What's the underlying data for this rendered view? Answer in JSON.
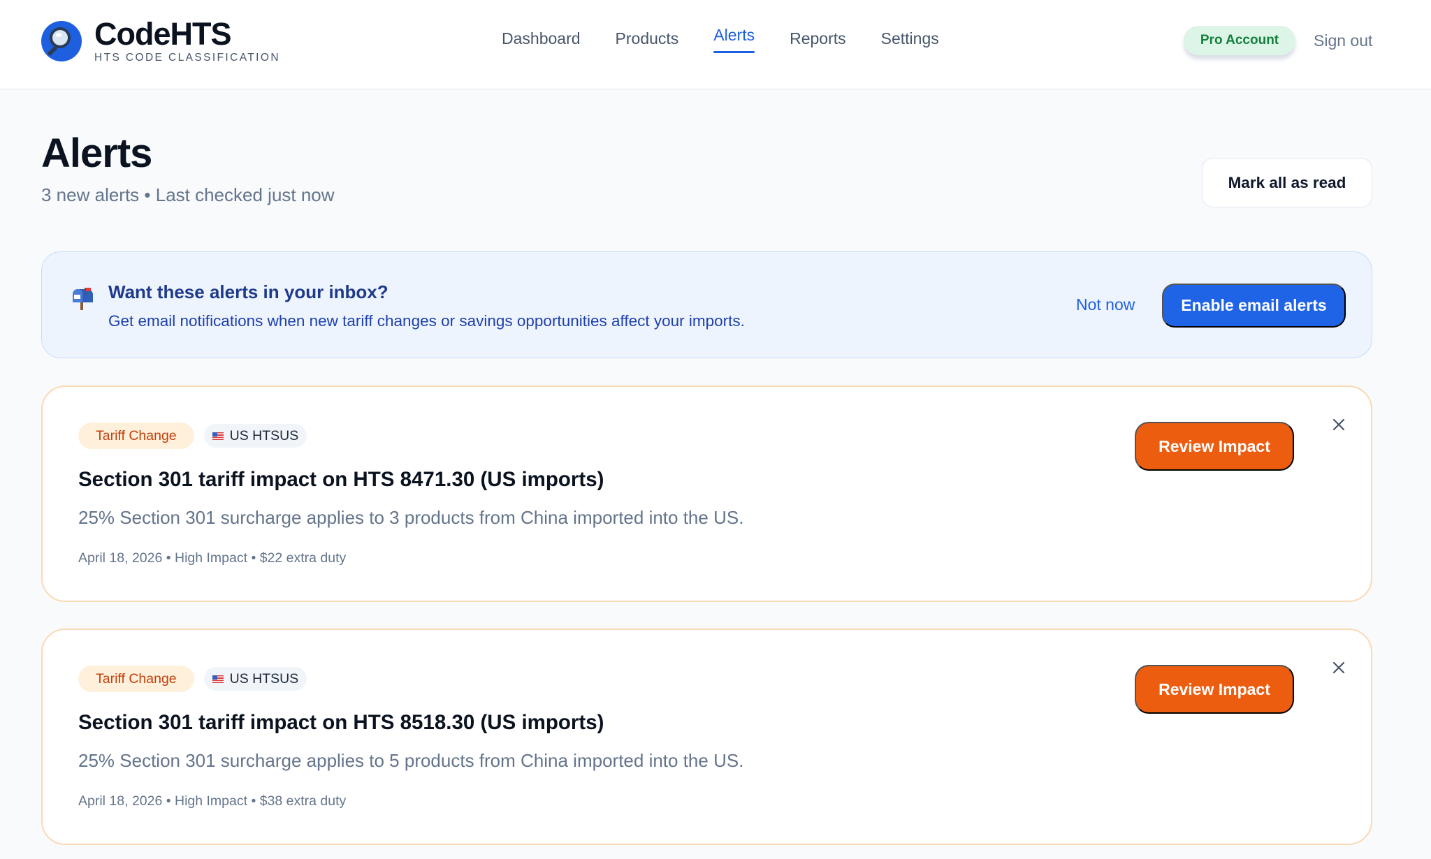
{
  "header": {
    "brand_name": "CodeHTS",
    "brand_tagline": "HTS CODE CLASSIFICATION",
    "nav": [
      {
        "label": "Dashboard",
        "active": false
      },
      {
        "label": "Products",
        "active": false
      },
      {
        "label": "Alerts",
        "active": true
      },
      {
        "label": "Reports",
        "active": false
      },
      {
        "label": "Settings",
        "active": false
      }
    ],
    "account_badge": "Pro Account",
    "sign_out": "Sign out"
  },
  "page": {
    "title": "Alerts",
    "subtitle": "3 new alerts • Last checked just now",
    "mark_all_label": "Mark all as read"
  },
  "email_banner": {
    "icon": "mailbox-icon",
    "title": "Want these alerts in your inbox?",
    "text": "Get email notifications when new tariff changes or savings opportunities affect your imports.",
    "dismiss_label": "Not now",
    "enable_label": "Enable email alerts"
  },
  "alerts": [
    {
      "type": "Tariff Change",
      "region": "US HTSUS",
      "title": "Section 301 tariff impact on HTS 8471.30 (US imports)",
      "description": "25% Section 301 surcharge applies to 3 products from China imported into the US.",
      "meta": "April 18, 2026 • High Impact • $22 extra duty",
      "action_label": "Review Impact"
    },
    {
      "type": "Tariff Change",
      "region": "US HTSUS",
      "title": "Section 301 tariff impact on HTS 8518.30 (US imports)",
      "description": "25% Section 301 surcharge applies to 5 products from China imported into the US.",
      "meta": "April 18, 2026 • High Impact • $38 extra duty",
      "action_label": "Review Impact"
    }
  ],
  "colors": {
    "accent_blue": "#1f63e6",
    "action_orange": "#ec5d10",
    "pro_green": "#15803d"
  }
}
